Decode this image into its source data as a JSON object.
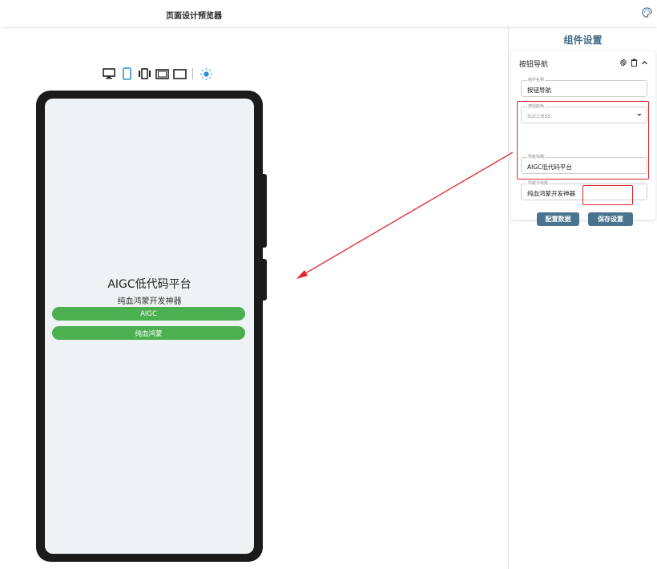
{
  "app": {
    "title": "页面设计预览器",
    "palette_icon": "palette-icon"
  },
  "toolbar": {
    "devices": [
      "desktop-icon",
      "phone-icon",
      "foldable-icon",
      "tablet-landscape-icon",
      "tablet-icon"
    ],
    "selected_device": "phone-icon",
    "theme_icon": "sun-icon"
  },
  "preview": {
    "nav_title": "AIGC低代码平台",
    "nav_subtitle": "纯血鸿蒙开发神器",
    "buttons": [
      "AIGC",
      "纯血鸿蒙"
    ],
    "button_color": "#4caf50"
  },
  "panel": {
    "title": "组件设置",
    "component": {
      "name": "按钮导航",
      "fields": [
        {
          "label": "组件名称",
          "value": "按钮导航"
        },
        {
          "label": "按钮颜色",
          "value": "success"
        },
        {
          "label": "导航标题",
          "value": "AIGC低代码平台"
        },
        {
          "label": "导航子标题",
          "value": "纯血鸿蒙开发神器"
        }
      ],
      "config_label": "配置数据",
      "save_label": "保存设置"
    },
    "accent_color": "#3f6b86",
    "highlight_color": "#e0242b"
  }
}
